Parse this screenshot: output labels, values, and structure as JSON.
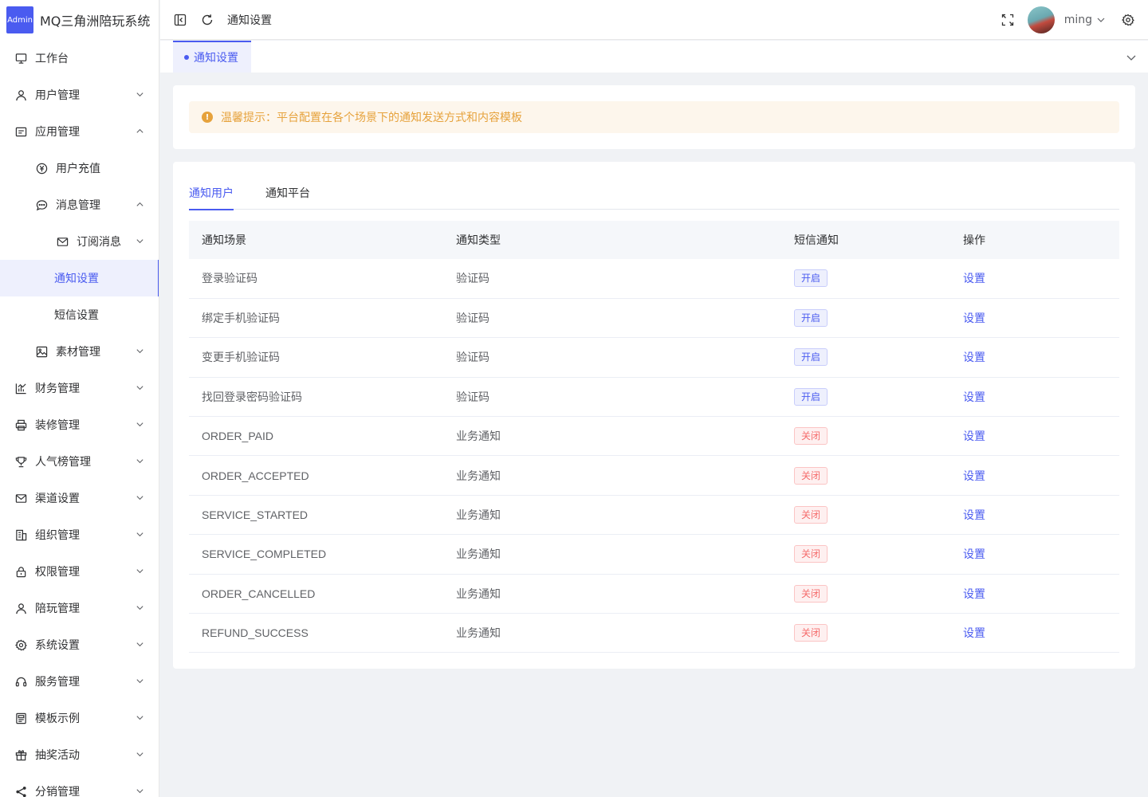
{
  "app": {
    "badge": "Admin",
    "title": "MQ三角洲陪玩系统"
  },
  "header": {
    "breadcrumb": "通知设置",
    "username": "ming"
  },
  "sidebar": [
    {
      "label": "工作台",
      "icon": "monitor-icon",
      "level": 0
    },
    {
      "label": "用户管理",
      "icon": "user-icon",
      "level": 0,
      "chevron": "down"
    },
    {
      "label": "应用管理",
      "icon": "app-card-icon",
      "level": 0,
      "chevron": "up"
    },
    {
      "label": "用户充值",
      "icon": "coin-icon",
      "level": 1
    },
    {
      "label": "消息管理",
      "icon": "chat-icon",
      "level": 1,
      "chevron": "up"
    },
    {
      "label": "订阅消息",
      "icon": "mail-icon",
      "level": 2,
      "chevron": "down"
    },
    {
      "label": "通知设置",
      "level": 3,
      "active": true
    },
    {
      "label": "短信设置",
      "level": 3
    },
    {
      "label": "素材管理",
      "icon": "image-icon",
      "level": 1,
      "chevron": "down"
    },
    {
      "label": "财务管理",
      "icon": "chart-icon",
      "level": 0,
      "chevron": "down"
    },
    {
      "label": "装修管理",
      "icon": "printer-icon",
      "level": 0,
      "chevron": "down"
    },
    {
      "label": "人气榜管理",
      "icon": "trophy-icon",
      "level": 0,
      "chevron": "down"
    },
    {
      "label": "渠道设置",
      "icon": "mail-icon",
      "level": 0,
      "chevron": "down"
    },
    {
      "label": "组织管理",
      "icon": "building-icon",
      "level": 0,
      "chevron": "down"
    },
    {
      "label": "权限管理",
      "icon": "lock-icon",
      "level": 0,
      "chevron": "down"
    },
    {
      "label": "陪玩管理",
      "icon": "user-icon",
      "level": 0,
      "chevron": "down"
    },
    {
      "label": "系统设置",
      "icon": "gear-icon",
      "level": 0,
      "chevron": "down"
    },
    {
      "label": "服务管理",
      "icon": "headset-icon",
      "level": 0,
      "chevron": "down"
    },
    {
      "label": "模板示例",
      "icon": "template-icon",
      "level": 0,
      "chevron": "down"
    },
    {
      "label": "抽奖活动",
      "icon": "gift-icon",
      "level": 0,
      "chevron": "down"
    },
    {
      "label": "分销管理",
      "icon": "share-icon",
      "level": 0,
      "chevron": "down"
    }
  ],
  "tags": [
    {
      "label": "通知设置"
    }
  ],
  "alert": {
    "text": "温馨提示：平台配置在各个场景下的通知发送方式和内容模板"
  },
  "tabs": [
    {
      "label": "通知用户",
      "active": true
    },
    {
      "label": "通知平台"
    }
  ],
  "table": {
    "headers": [
      "通知场景",
      "通知类型",
      "短信通知",
      "操作"
    ],
    "rows": [
      {
        "scene": "登录验证码",
        "type": "验证码",
        "sms": "开启",
        "status": "on",
        "action": "设置"
      },
      {
        "scene": "绑定手机验证码",
        "type": "验证码",
        "sms": "开启",
        "status": "on",
        "action": "设置"
      },
      {
        "scene": "变更手机验证码",
        "type": "验证码",
        "sms": "开启",
        "status": "on",
        "action": "设置"
      },
      {
        "scene": "找回登录密码验证码",
        "type": "验证码",
        "sms": "开启",
        "status": "on",
        "action": "设置"
      },
      {
        "scene": "ORDER_PAID",
        "type": "业务通知",
        "sms": "关闭",
        "status": "off",
        "action": "设置"
      },
      {
        "scene": "ORDER_ACCEPTED",
        "type": "业务通知",
        "sms": "关闭",
        "status": "off",
        "action": "设置"
      },
      {
        "scene": "SERVICE_STARTED",
        "type": "业务通知",
        "sms": "关闭",
        "status": "off",
        "action": "设置"
      },
      {
        "scene": "SERVICE_COMPLETED",
        "type": "业务通知",
        "sms": "关闭",
        "status": "off",
        "action": "设置"
      },
      {
        "scene": "ORDER_CANCELLED",
        "type": "业务通知",
        "sms": "关闭",
        "status": "off",
        "action": "设置"
      },
      {
        "scene": "REFUND_SUCCESS",
        "type": "业务通知",
        "sms": "关闭",
        "status": "off",
        "action": "设置"
      }
    ]
  },
  "colors": {
    "primary": "#4a5bf0",
    "warning": "#e6a23c",
    "danger": "#f56c6c"
  }
}
